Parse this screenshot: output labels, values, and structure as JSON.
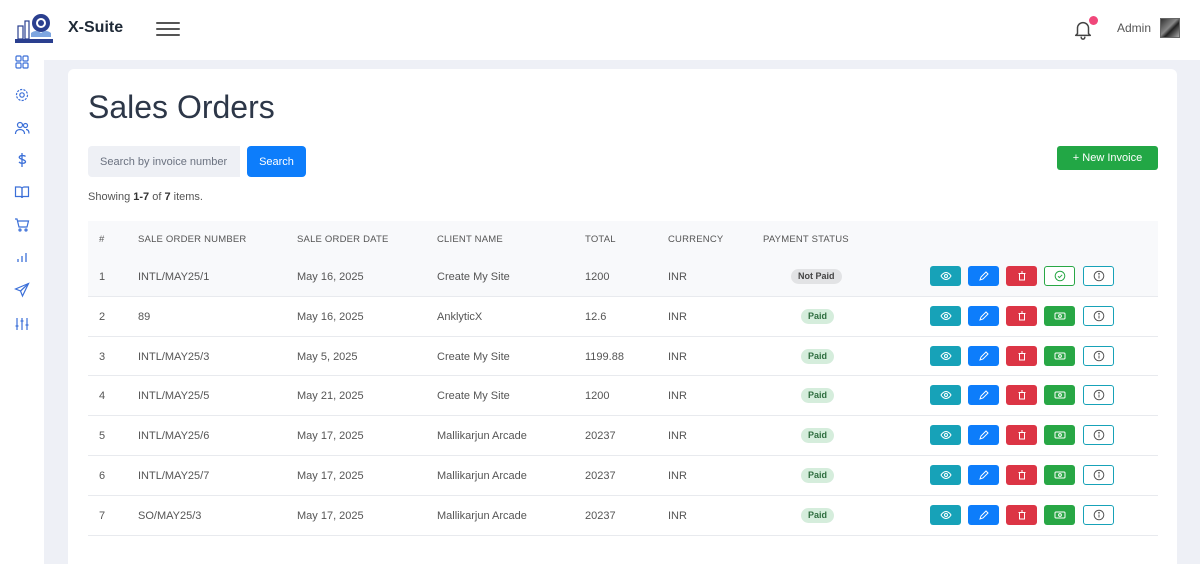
{
  "app": {
    "brand": "X-Suite"
  },
  "header": {
    "user_name": "Admin"
  },
  "sidebar": {
    "icons": [
      "dashboard-icon",
      "settings-icon",
      "users-icon",
      "dollar-icon",
      "book-icon",
      "cart-icon",
      "chart-icon",
      "send-icon",
      "sliders-icon"
    ]
  },
  "page": {
    "title": "Sales Orders",
    "search_placeholder": "Search by invoice number",
    "search_label": "Search",
    "new_invoice_label": "+ New Invoice",
    "showing": {
      "prefix": "Showing ",
      "range": "1-7",
      "of": " of ",
      "total": "7",
      "suffix": " items."
    }
  },
  "table": {
    "columns": [
      "#",
      "SALE ORDER NUMBER",
      "SALE ORDER DATE",
      "CLIENT NAME",
      "TOTAL",
      "CURRENCY",
      "PAYMENT STATUS"
    ],
    "rows": [
      {
        "num": "1",
        "order": "INTL/MAY25/1",
        "date": "May 16, 2025",
        "client": "Create My Site",
        "total": "1200",
        "currency": "INR",
        "status": "Not Paid"
      },
      {
        "num": "2",
        "order": "89",
        "date": "May 16, 2025",
        "client": "AnklyticX",
        "total": "12.6",
        "currency": "INR",
        "status": "Paid"
      },
      {
        "num": "3",
        "order": "INTL/MAY25/3",
        "date": "May 5, 2025",
        "client": "Create My Site",
        "total": "1199.88",
        "currency": "INR",
        "status": "Paid"
      },
      {
        "num": "4",
        "order": "INTL/MAY25/5",
        "date": "May 21, 2025",
        "client": "Create My Site",
        "total": "1200",
        "currency": "INR",
        "status": "Paid"
      },
      {
        "num": "5",
        "order": "INTL/MAY25/6",
        "date": "May 17, 2025",
        "client": "Mallikarjun Arcade",
        "total": "20237",
        "currency": "INR",
        "status": "Paid"
      },
      {
        "num": "6",
        "order": "INTL/MAY25/7",
        "date": "May 17, 2025",
        "client": "Mallikarjun Arcade",
        "total": "20237",
        "currency": "INR",
        "status": "Paid"
      },
      {
        "num": "7",
        "order": "SO/MAY25/3",
        "date": "May 17, 2025",
        "client": "Mallikarjun Arcade",
        "total": "20237",
        "currency": "INR",
        "status": "Paid"
      }
    ]
  },
  "colors": {
    "primary": "#0d7dfb",
    "success": "#22a745",
    "danger": "#dc3545",
    "info": "#17a2b8"
  }
}
